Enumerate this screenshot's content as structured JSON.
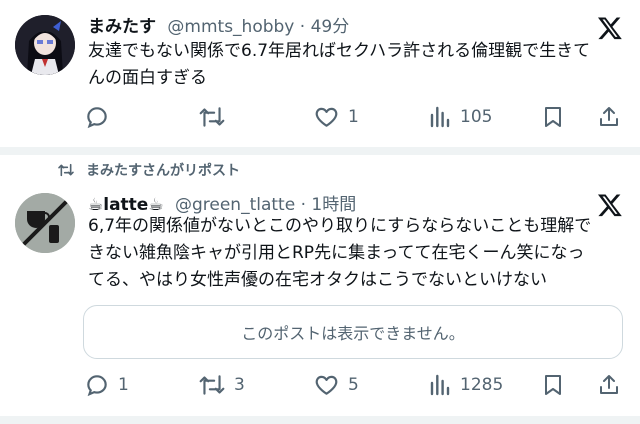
{
  "post1": {
    "display_name": "まみたす",
    "handle": "@mmts_hobby",
    "time": "49分",
    "text_lines": [
      "友達でもない関係で6.7年居ればセクハラ許される倫理観で生きて",
      "んの面白すぎる"
    ],
    "actions": {
      "reply_count": "",
      "repost_count": "",
      "like_count": "1",
      "views_count": "105"
    }
  },
  "repost_banner": "まみたすさんがリポスト",
  "post2": {
    "display_name": "☕latte☕",
    "handle": "@green_tlatte",
    "time": "1時間",
    "text_lines": [
      "6,7年の関係値がないとこのやり取りにすらならないことも理解で",
      "きない雑魚陰キャが引用とRP先に集まってて在宅くーん笑になっ",
      "てる、やはり女性声優の在宅オタクはこうでないといけない"
    ],
    "quote_unavailable": "このポストは表示できません。",
    "actions": {
      "reply_count": "1",
      "repost_count": "3",
      "like_count": "5",
      "views_count": "1285"
    }
  },
  "colors": {
    "text": "#0f1419",
    "secondary": "#536471",
    "border": "#cfd9de",
    "divider": "#eff3f4"
  }
}
